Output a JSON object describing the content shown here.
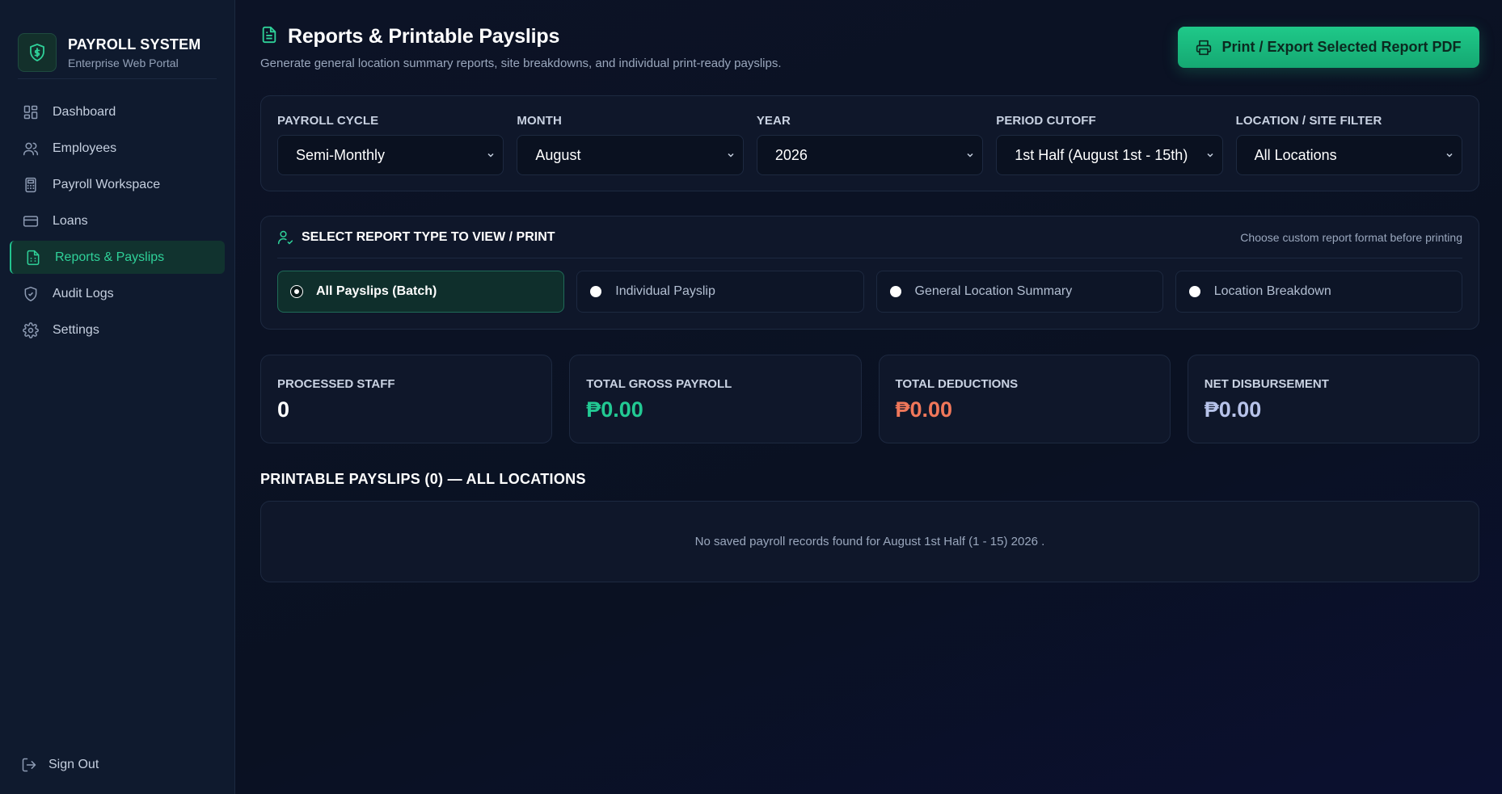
{
  "brand": {
    "title": "PAYROLL SYSTEM",
    "subtitle": "Enterprise Web Portal"
  },
  "nav": [
    {
      "label": "Dashboard",
      "icon": "dashboard-icon"
    },
    {
      "label": "Employees",
      "icon": "users-icon"
    },
    {
      "label": "Payroll Workspace",
      "icon": "calculator-icon"
    },
    {
      "label": "Loans",
      "icon": "credit-card-icon"
    },
    {
      "label": "Reports & Payslips",
      "icon": "file-spreadsheet-icon",
      "active": true
    },
    {
      "label": "Audit Logs",
      "icon": "shield-icon"
    },
    {
      "label": "Settings",
      "icon": "gear-icon"
    }
  ],
  "signout": "Sign Out",
  "header": {
    "title": "Reports & Printable Payslips",
    "subtitle": "Generate general location summary reports, site breakdowns, and individual print-ready payslips.",
    "print_button": "Print / Export Selected Report PDF"
  },
  "filters": {
    "payroll_cycle": {
      "label": "PAYROLL CYCLE",
      "value": "Semi-Monthly"
    },
    "month": {
      "label": "MONTH",
      "value": "August"
    },
    "year": {
      "label": "YEAR",
      "value": "2026"
    },
    "period_cutoff": {
      "label": "PERIOD CUTOFF",
      "value": "1st Half (August 1st - 15th)"
    },
    "location": {
      "label": "LOCATION / SITE FILTER",
      "value": "All Locations"
    }
  },
  "report_type": {
    "title": "SELECT REPORT TYPE TO VIEW / PRINT",
    "hint": "Choose custom report format before printing",
    "options": [
      {
        "label": "All Payslips (Batch)",
        "selected": true
      },
      {
        "label": "Individual Payslip"
      },
      {
        "label": "General Location Summary"
      },
      {
        "label": "Location Breakdown"
      }
    ]
  },
  "stats": [
    {
      "label": "PROCESSED STAFF",
      "value": "0",
      "color": "#ffffff"
    },
    {
      "label": "TOTAL GROSS PAYROLL",
      "value": "₱0.00",
      "color": "#22c993"
    },
    {
      "label": "TOTAL DEDUCTIONS",
      "value": "₱0.00",
      "color": "#f0775a"
    },
    {
      "label": "NET DISBURSEMENT",
      "value": "₱0.00",
      "color": "#b7c3ea"
    }
  ],
  "payslips": {
    "title": "PRINTABLE PAYSLIPS (0) — ALL LOCATIONS",
    "empty_message": "No saved payroll records found for August 1st Half (1 - 15) 2026 ."
  },
  "colors": {
    "accent": "#22c48f",
    "background": "#0b1224"
  }
}
